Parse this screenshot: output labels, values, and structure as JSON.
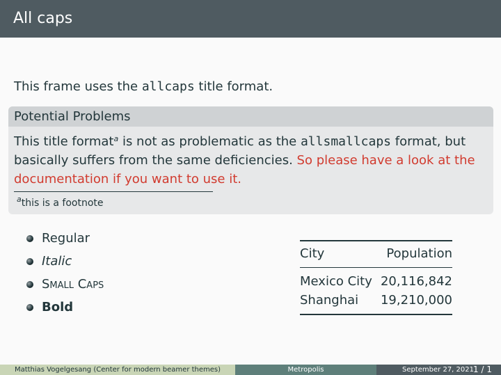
{
  "frame": {
    "title": "All caps"
  },
  "intro": {
    "before": "This frame uses the ",
    "code": "allcaps",
    "after": " title format."
  },
  "block": {
    "title": "Potential Problems",
    "text1": "This title format",
    "footnote_mark": "a",
    "text2": " is not as problematic as the ",
    "code": "allsmallcaps",
    "text3": " format, but basically suffers from the same deficiencies. ",
    "alert": "So please have a look at the documentation if you want to use it.",
    "footnote_text": "this is a footnote"
  },
  "list": {
    "items": [
      "Regular",
      "Italic",
      "Small Caps",
      "Bold"
    ]
  },
  "table": {
    "headers": [
      "City",
      "Population"
    ],
    "rows": [
      [
        "Mexico City",
        "20,116,842"
      ],
      [
        "Shanghai",
        "19,210,000"
      ]
    ]
  },
  "footer": {
    "author": "Matthias Vogelgesang (Center for modern beamer themes)",
    "short_title": "Metropolis",
    "date": "September 27, 2021",
    "page": "1 / 1"
  },
  "colors": {
    "titlebar": "#4f5b61",
    "alert": "#d13b2f",
    "block_title": "#cfd2d4",
    "block_body": "#e7e8e9",
    "footer_left": "#c9d5b6",
    "footer_mid": "#5e7f7a"
  }
}
